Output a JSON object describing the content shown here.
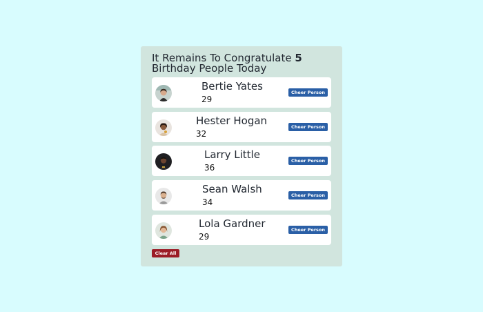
{
  "heading": {
    "prefix": "It Remains To Congratulate",
    "count": "5",
    "suffix": "Birthday People Today"
  },
  "people": [
    {
      "name": "Bertie Yates",
      "age": "29",
      "button": "Cheer Person"
    },
    {
      "name": "Hester Hogan",
      "age": "32",
      "button": "Cheer Person"
    },
    {
      "name": "Larry Little",
      "age": "36",
      "button": "Cheer Person"
    },
    {
      "name": "Sean Walsh",
      "age": "34",
      "button": "Cheer Person"
    },
    {
      "name": "Lola Gardner",
      "age": "29",
      "button": "Cheer Person"
    }
  ],
  "clear_label": "Clear All",
  "colors": {
    "page_background": "#d8fcfe",
    "panel_background": "#d1e5de",
    "cheer_button": "#2a5fa6",
    "clear_button": "#9b1c26"
  }
}
